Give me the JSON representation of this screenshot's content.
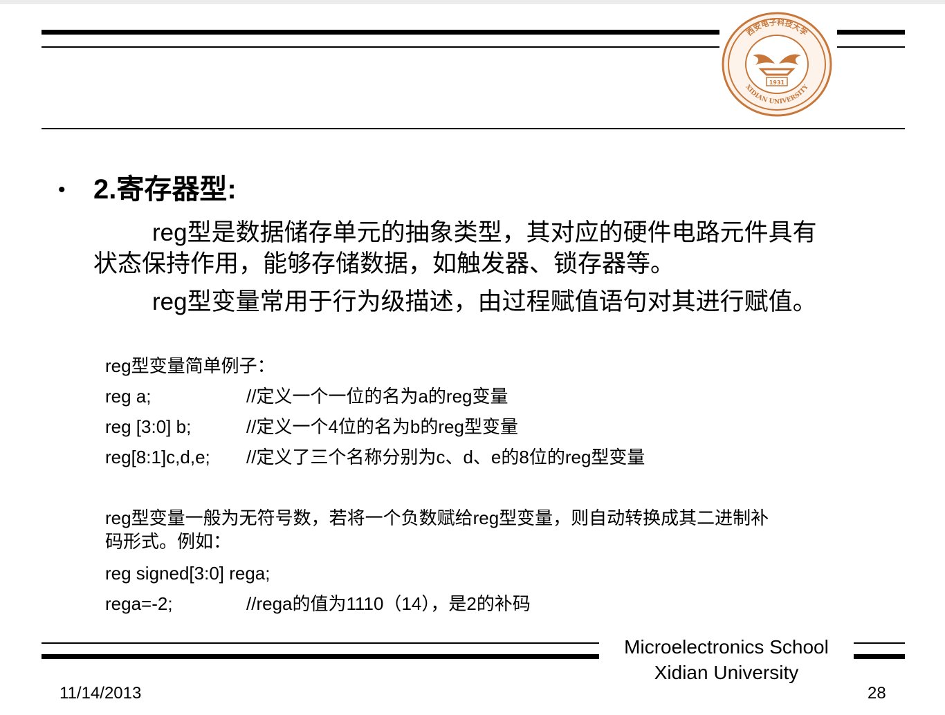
{
  "header": {
    "logo_text_top": "西安电子科技大学",
    "logo_text_bottom": "XIDIAN UNIVERSITY",
    "logo_year": "1931",
    "logo_color": "#c7773a"
  },
  "content": {
    "bullet": "•",
    "heading": "2.寄存器型:",
    "para1_line1": "reg型是数据储存单元的抽象类型，其对应的硬件电路元件具有",
    "para1_line2": "状态保持作用，能够存储数据，如触发器、锁存器等。",
    "para2": "reg型变量常用于行为级描述，由过程赋值语句对其进行赋值。",
    "example_title": "reg型变量简单例子：",
    "examples": [
      {
        "code": "reg a;",
        "comment": "//定义一个一位的名为a的reg变量"
      },
      {
        "code": "reg [3:0] b;",
        "comment": "//定义一个4位的名为b的reg型变量"
      },
      {
        "code": "reg[8:1]c,d,e;",
        "comment": "//定义了三个名称分别为c、d、e的8位的reg型变量"
      }
    ],
    "note_line1": "reg型变量一般为无符号数，若将一个负数赋给reg型变量，则自动转换成其二进制补",
    "note_line2": "码形式。例如：",
    "signed_decl": "reg signed[3:0]  rega;",
    "assign_code": "rega=-2;",
    "assign_comment": "//rega的值为1110（14），是2的补码"
  },
  "footer": {
    "school_line1": "Microelectronics School",
    "school_line2": "Xidian University",
    "date": "11/14/2013",
    "page_number": "28"
  }
}
